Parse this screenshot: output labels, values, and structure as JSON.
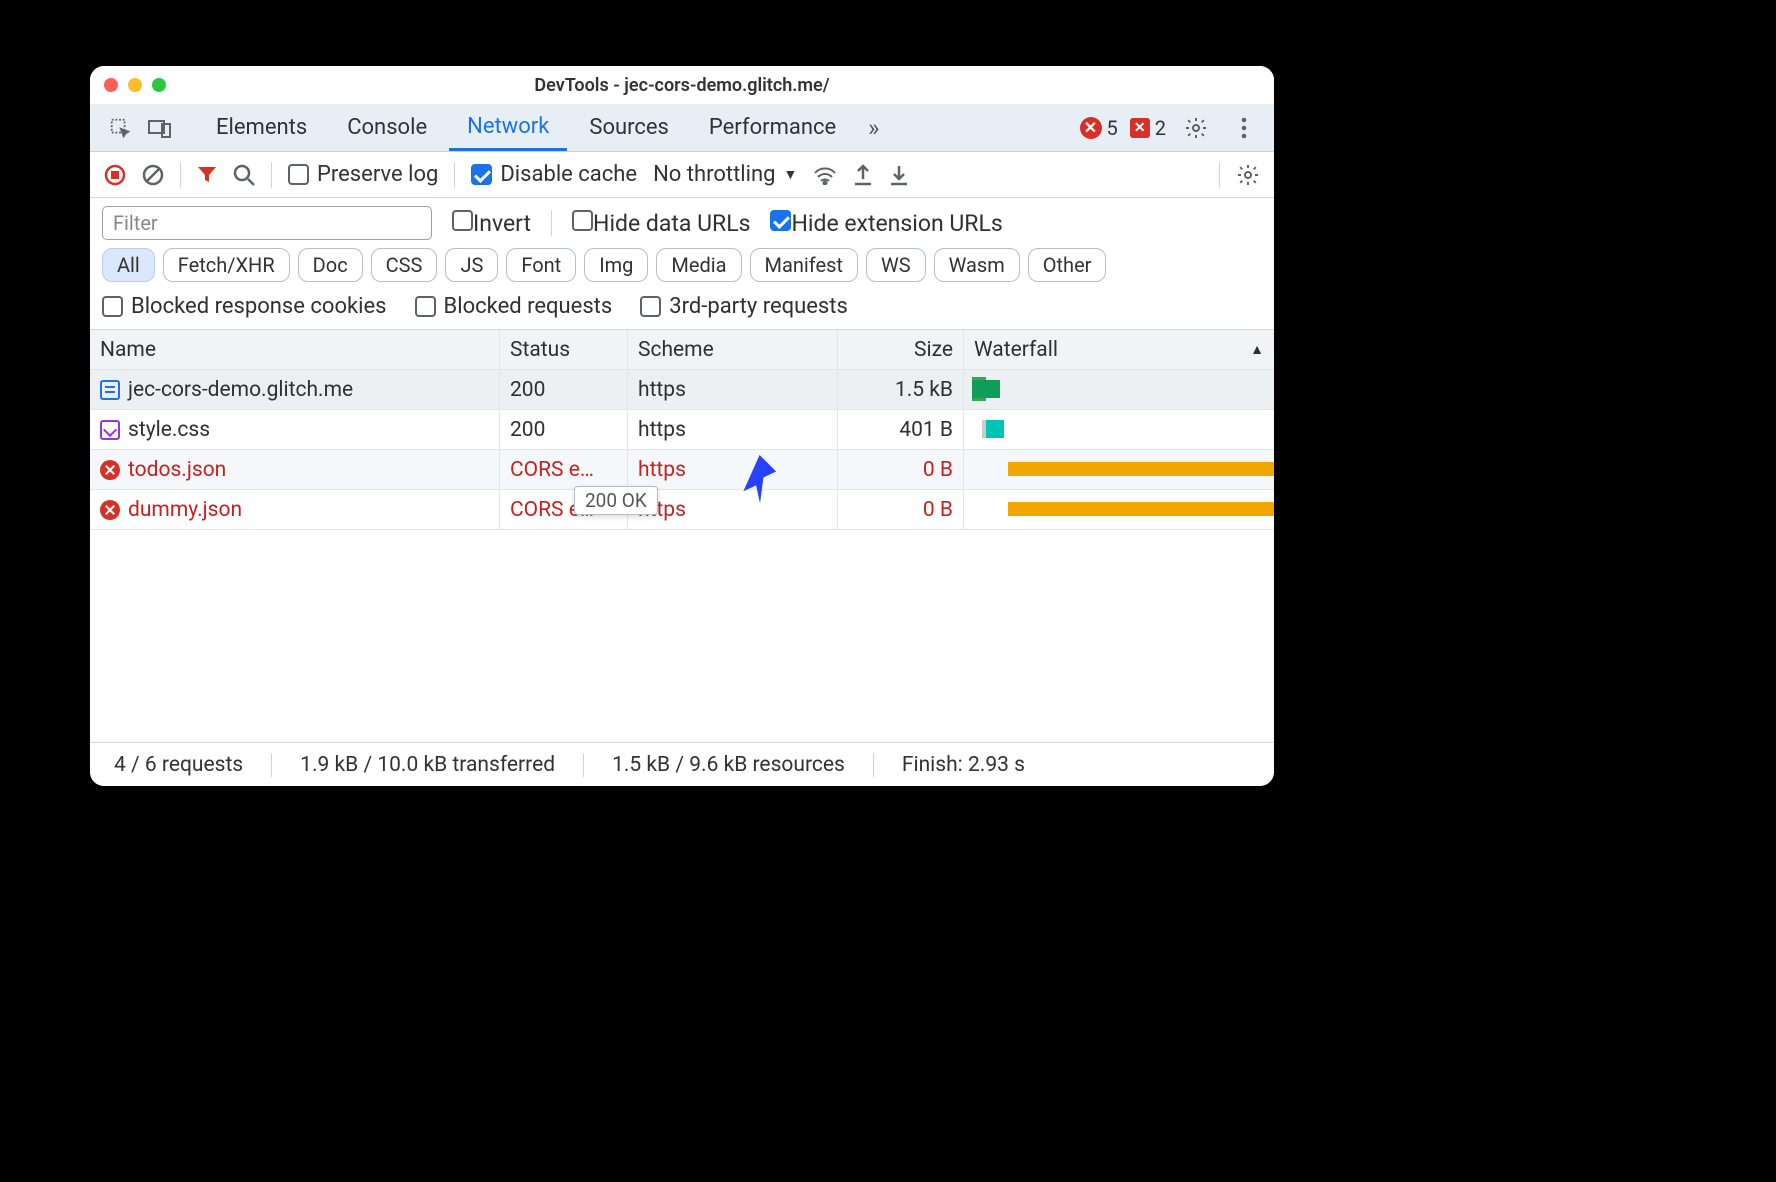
{
  "window": {
    "title": "DevTools - jec-cors-demo.glitch.me/"
  },
  "tabs": {
    "items": [
      "Elements",
      "Console",
      "Network",
      "Sources",
      "Performance"
    ],
    "active": "Network",
    "errors": "5",
    "issues": "2"
  },
  "toolbar": {
    "preserve_log": "Preserve log",
    "disable_cache": "Disable cache",
    "throttling": "No throttling"
  },
  "filters": {
    "placeholder": "Filter",
    "invert": "Invert",
    "hide_data_urls": "Hide data URLs",
    "hide_extension_urls": "Hide extension URLs",
    "types": [
      "All",
      "Fetch/XHR",
      "Doc",
      "CSS",
      "JS",
      "Font",
      "Img",
      "Media",
      "Manifest",
      "WS",
      "Wasm",
      "Other"
    ],
    "blocked_cookies": "Blocked response cookies",
    "blocked_requests": "Blocked requests",
    "third_party": "3rd-party requests"
  },
  "columns": {
    "name": "Name",
    "status": "Status",
    "scheme": "Scheme",
    "size": "Size",
    "waterfall": "Waterfall"
  },
  "rows": [
    {
      "name": "jec-cors-demo.glitch.me",
      "status": "200",
      "scheme": "https",
      "size": "1.5 kB",
      "icon": "doc",
      "err": false
    },
    {
      "name": "style.css",
      "status": "200",
      "scheme": "https",
      "size": "401 B",
      "icon": "css",
      "err": false
    },
    {
      "name": "todos.json",
      "status": "CORS e…",
      "scheme": "https",
      "size": "0 B",
      "icon": "err",
      "err": true
    },
    {
      "name": "dummy.json",
      "status": "CORS e…",
      "scheme": "https",
      "size": "0 B",
      "icon": "err",
      "err": true
    }
  ],
  "tooltip": "200 OK",
  "footer": {
    "requests": "4 / 6 requests",
    "transferred": "1.9 kB / 10.0 kB transferred",
    "resources": "1.5 kB / 9.6 kB resources",
    "finish": "Finish: 2.93 s"
  }
}
